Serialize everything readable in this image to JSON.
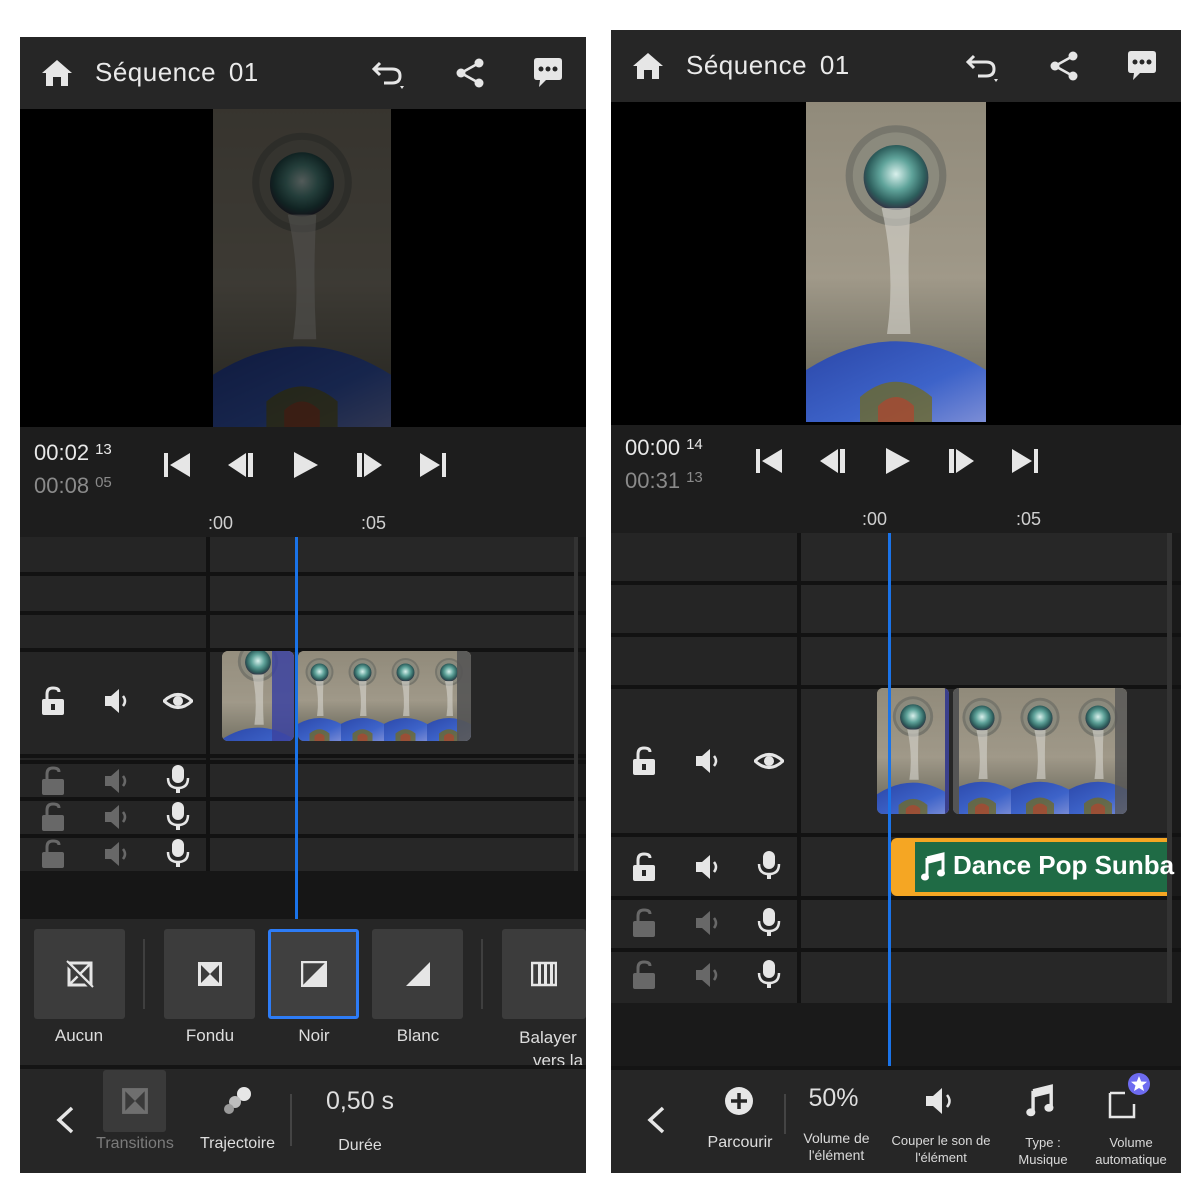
{
  "left": {
    "header": {
      "title": "Séquence  01"
    },
    "timecode": {
      "current_main": "00:02",
      "current_frames": "13",
      "total_main": "00:08",
      "total_frames": "05"
    },
    "ruler": {
      "mark0": ":00",
      "mark5": ":05"
    },
    "transitions": {
      "none": "Aucun",
      "fade": "Fondu",
      "black": "Noir",
      "white": "Blanc",
      "wipe_line1": "Balayer",
      "wipe_line2": "vers la"
    },
    "toolbar": {
      "transitions": "Transitions",
      "trajectory": "Trajectoire",
      "duration_value": "0,50 s",
      "duration": "Durée"
    }
  },
  "right": {
    "header": {
      "title": "Séquence  01"
    },
    "timecode": {
      "current_main": "00:00",
      "current_frames": "14",
      "total_main": "00:31",
      "total_frames": "13"
    },
    "ruler": {
      "mark0": ":00",
      "mark5": ":05"
    },
    "music_clip": {
      "title": "Dance Pop Sunba"
    },
    "toolbar": {
      "browse": "Parcourir",
      "volume_value": "50%",
      "clip_volume_l1": "Volume de",
      "clip_volume_l2": "l'élément",
      "mute_l1": "Couper le son de",
      "mute_l2": "l'élément",
      "type_l1": "Type :",
      "type_l2": "Musique",
      "auto_l1": "Volume",
      "auto_l2": "automatique"
    }
  },
  "colors": {
    "playhead": "#1a73e8",
    "selection": "#2d7cf6",
    "music_clip_edge": "#f5a623",
    "music_clip_body": "#1f6b45",
    "badge": "#6d6bf0"
  }
}
